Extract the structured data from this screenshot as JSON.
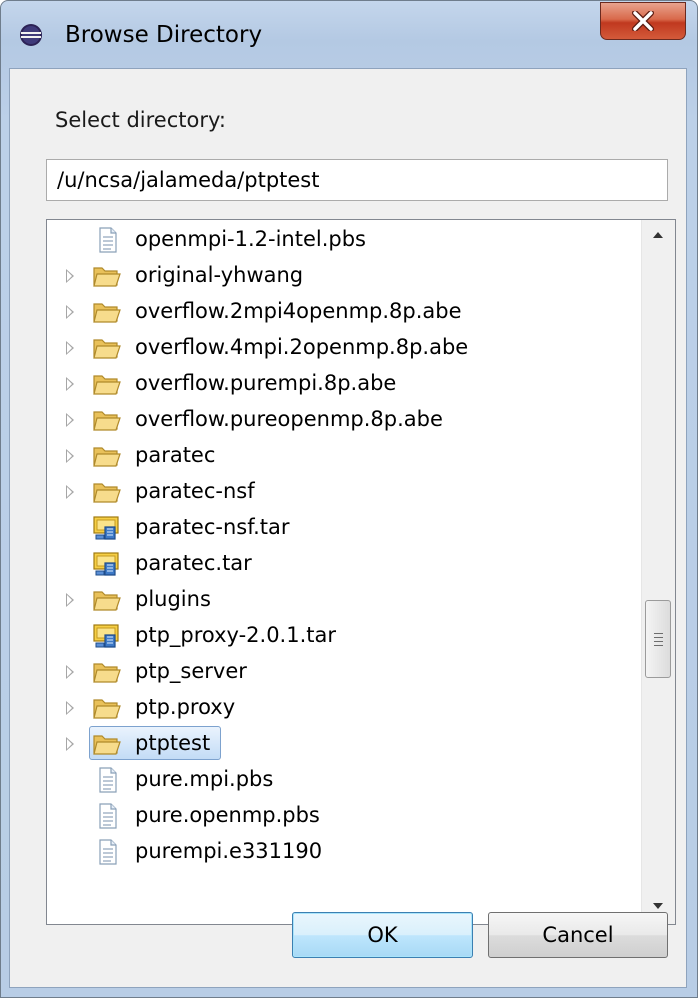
{
  "window": {
    "title": "Browse Directory",
    "app_icon": "eclipse-icon",
    "close_label": "X"
  },
  "dialog": {
    "prompt_label": "Select directory:",
    "path_value": "/u/ncsa/jalameda/ptptest"
  },
  "tree": {
    "items": [
      {
        "label": "openmpi-1.2-intel.pbs",
        "icon": "file-icon",
        "expandable": false,
        "selected": false
      },
      {
        "label": "original-yhwang",
        "icon": "folder-icon",
        "expandable": true,
        "selected": false
      },
      {
        "label": "overflow.2mpi4openmp.8p.abe",
        "icon": "folder-icon",
        "expandable": true,
        "selected": false
      },
      {
        "label": "overflow.4mpi.2openmp.8p.abe",
        "icon": "folder-icon",
        "expandable": true,
        "selected": false
      },
      {
        "label": "overflow.purempi.8p.abe",
        "icon": "folder-icon",
        "expandable": true,
        "selected": false
      },
      {
        "label": "overflow.pureopenmp.8p.abe",
        "icon": "folder-icon",
        "expandable": true,
        "selected": false
      },
      {
        "label": "paratec",
        "icon": "folder-icon",
        "expandable": true,
        "selected": false
      },
      {
        "label": "paratec-nsf",
        "icon": "folder-icon",
        "expandable": true,
        "selected": false
      },
      {
        "label": "paratec-nsf.tar",
        "icon": "archive-icon",
        "expandable": false,
        "selected": false
      },
      {
        "label": "paratec.tar",
        "icon": "archive-icon",
        "expandable": false,
        "selected": false
      },
      {
        "label": "plugins",
        "icon": "folder-icon",
        "expandable": true,
        "selected": false
      },
      {
        "label": "ptp_proxy-2.0.1.tar",
        "icon": "archive-icon",
        "expandable": false,
        "selected": false
      },
      {
        "label": "ptp_server",
        "icon": "folder-icon",
        "expandable": true,
        "selected": false
      },
      {
        "label": "ptp.proxy",
        "icon": "folder-icon",
        "expandable": true,
        "selected": false
      },
      {
        "label": "ptptest",
        "icon": "folder-icon",
        "expandable": true,
        "selected": true
      },
      {
        "label": "pure.mpi.pbs",
        "icon": "file-icon",
        "expandable": false,
        "selected": false
      },
      {
        "label": "pure.openmp.pbs",
        "icon": "file-icon",
        "expandable": false,
        "selected": false
      },
      {
        "label": "purempi.e331190",
        "icon": "file-icon",
        "expandable": false,
        "selected": false
      }
    ]
  },
  "buttons": {
    "ok_label": "OK",
    "cancel_label": "Cancel"
  },
  "colors": {
    "selection_border": "#7da2ce",
    "folder_fill": "#f4d27a",
    "close_button": "#c7432a"
  }
}
